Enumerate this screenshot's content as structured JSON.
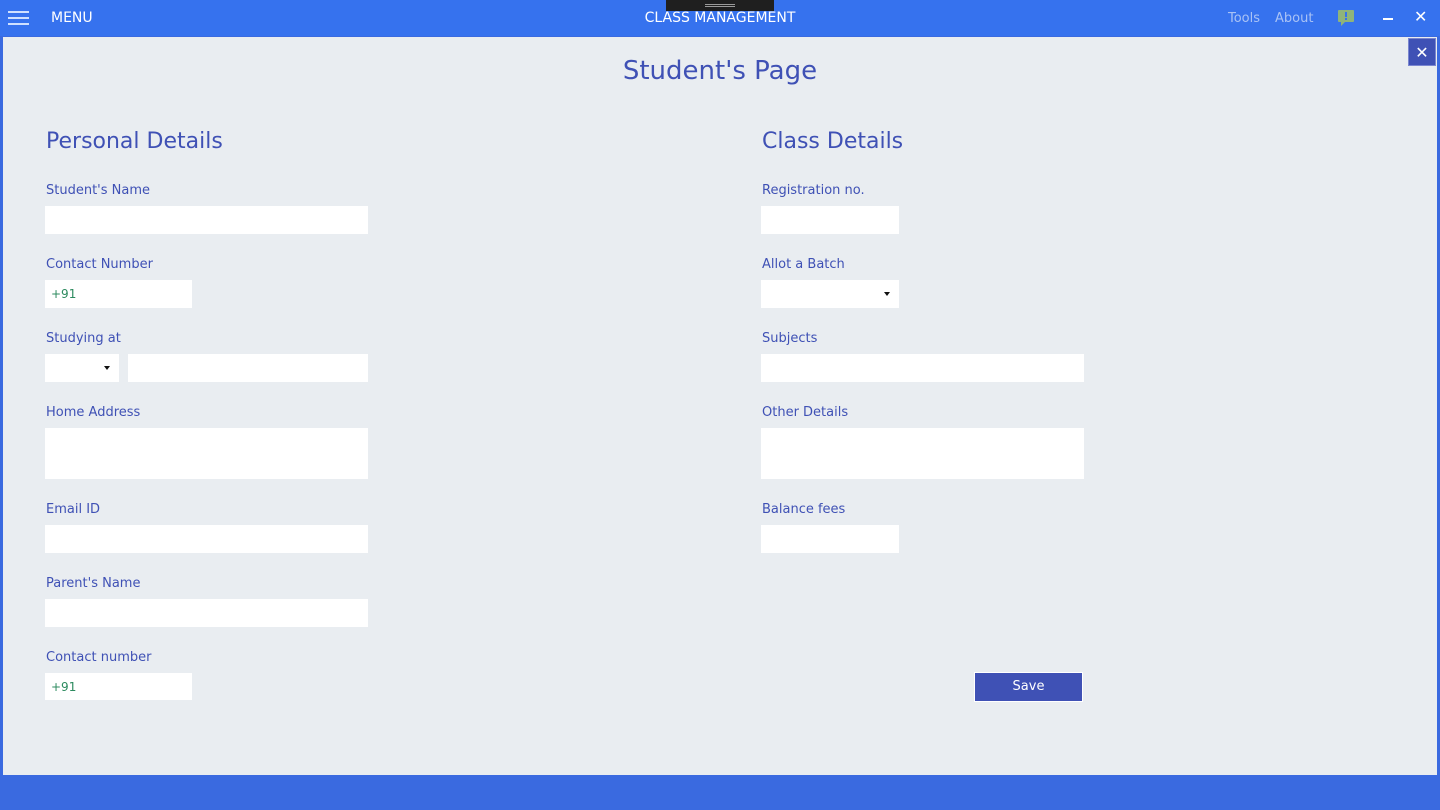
{
  "titlebar": {
    "menu_label": "MENU",
    "app_title": "CLASS MANAGEMENT",
    "links": [
      "Tools",
      "About"
    ],
    "icons": [
      "hamburger-icon",
      "feedback-icon",
      "minimize-icon",
      "close-icon"
    ],
    "close_glyph": "✕"
  },
  "page": {
    "title": "Student's Page",
    "close_glyph": "✕"
  },
  "personal": {
    "title": "Personal Details",
    "name_label": "Student's Name",
    "contact_label": "Contact Number",
    "contact_value": "+91",
    "studying_label": "Studying at",
    "address_label": "Home Address",
    "email_label": "Email ID",
    "parent_label": "Parent's Name",
    "parent_contact_label": "Contact number",
    "parent_contact_value": "+91"
  },
  "class": {
    "title": "Class Details",
    "reg_label": "Registration no.",
    "batch_label": "Allot a Batch",
    "subjects_label": "Subjects",
    "other_label": "Other Details",
    "fees_label": "Balance fees"
  },
  "actions": {
    "save_label": "Save"
  },
  "colors": {
    "accent": "#3f51b5",
    "titlebar": "#3672ee",
    "background": "#e9edf1"
  }
}
